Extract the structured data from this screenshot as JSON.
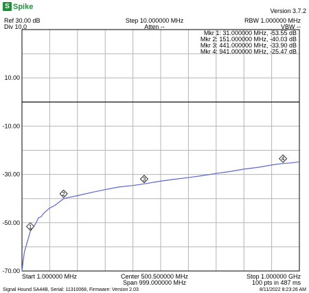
{
  "app": {
    "logo_mark": "S",
    "logo_text": "Spike",
    "version": "Version 3.7.2"
  },
  "header": {
    "ref_level": "Ref 30.00 dB",
    "div": "Div 10.0",
    "step": "Step 10.000000 MHz",
    "atten": "Atten --",
    "rbw": "RBW 1.000000 MHz",
    "vbw": "VBW --"
  },
  "markers": [
    {
      "id": "1",
      "label": "Mkr 1: 31.000000 MHz, -53.55 dB",
      "freq_mhz": 31,
      "level_db": -53.55
    },
    {
      "id": "2",
      "label": "Mkr 2: 151.000000 MHz, -40.03 dB",
      "freq_mhz": 151,
      "level_db": -40.03
    },
    {
      "id": "3",
      "label": "Mkr 3: 441.000000 MHz, -33.90 dB",
      "freq_mhz": 441,
      "level_db": -33.9
    },
    {
      "id": "4",
      "label": "Mkr 4: 941.000000 MHz, -25.47 dB",
      "freq_mhz": 941,
      "level_db": -25.47
    }
  ],
  "footer": {
    "start": "Start 1.000000 MHz",
    "center": "Center 500.500000 MHz",
    "span": "Span 999.000000 MHz",
    "stop": "Stop 1.000000 GHz",
    "points": "100 pts in 487 ms",
    "device": "Signal Hound SA44B, Serial: 11310068, Firmware: Version 2.03",
    "timestamp": "8/11/2022 8:23:26 AM"
  },
  "chart_data": {
    "type": "line",
    "ylim": [
      -70,
      30
    ],
    "xlim_mhz": [
      1,
      1000
    ],
    "ytick_labels": [
      "10.00",
      "-10.00",
      "-30.00",
      "-50.00",
      "-70.00"
    ],
    "ytick_values": [
      10,
      -10,
      -30,
      -50,
      -70
    ],
    "reference_line_db": 0,
    "trace_color": "#5865d8",
    "series": [
      {
        "x_mhz": [
          1,
          5,
          10,
          15,
          20,
          25,
          31,
          40,
          50,
          60,
          70,
          80,
          100,
          120,
          151,
          170,
          200,
          250,
          300,
          350,
          400,
          441,
          500,
          550,
          600,
          650,
          700,
          750,
          800,
          850,
          900,
          941,
          970,
          1000
        ],
        "y_db": [
          -70,
          -66,
          -62,
          -60,
          -58,
          -56,
          -53.55,
          -52,
          -50.5,
          -48,
          -47.5,
          -46,
          -44,
          -42.8,
          -40.03,
          -39.5,
          -38.8,
          -37.5,
          -36.3,
          -35.2,
          -34.6,
          -33.9,
          -32.8,
          -32,
          -31.3,
          -30.5,
          -29.6,
          -28.8,
          -27.8,
          -27.1,
          -26.1,
          -25.47,
          -25.2,
          -24.8
        ]
      }
    ]
  }
}
